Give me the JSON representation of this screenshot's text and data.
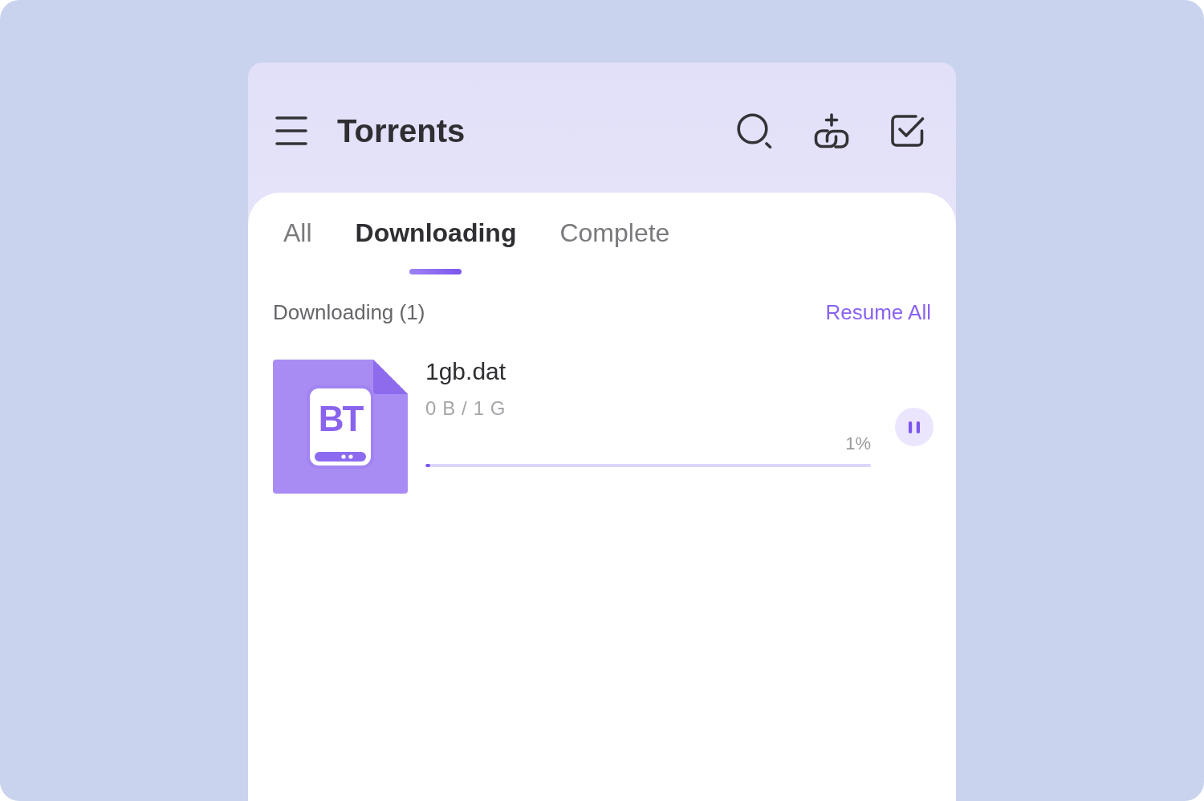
{
  "app_bar": {
    "title": "Torrents"
  },
  "tabs": [
    {
      "label": "All",
      "selected": false
    },
    {
      "label": "Downloading",
      "selected": true
    },
    {
      "label": "Complete",
      "selected": false
    }
  ],
  "section": {
    "heading": "Downloading (1)",
    "action": "Resume All"
  },
  "torrents": [
    {
      "icon_label": "BT",
      "name": "1gb.dat",
      "size": "0 B / 1 G",
      "percent": "1%",
      "level": 0.01,
      "paused": false
    }
  ]
}
